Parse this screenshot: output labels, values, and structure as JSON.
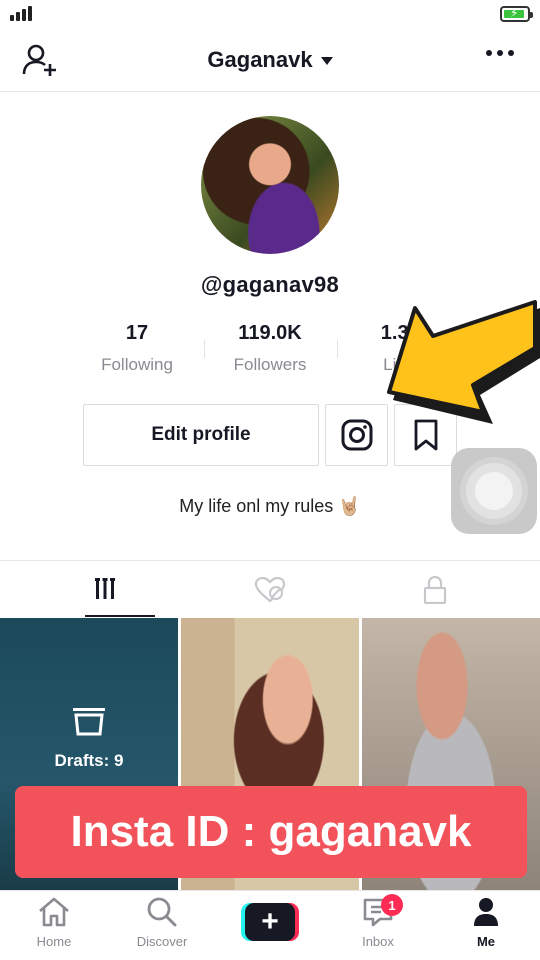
{
  "header": {
    "title": "Gaganavk"
  },
  "profile": {
    "username": "@gaganav98",
    "stats": [
      {
        "value": "17",
        "label": "Following"
      },
      {
        "value": "119.0K",
        "label": "Followers"
      },
      {
        "value": "1.3M",
        "label": "Likes"
      }
    ],
    "edit_label": "Edit profile",
    "bio": "My life onl my rules 🤘🏼"
  },
  "grid": {
    "drafts_label": "Drafts: 9"
  },
  "overlay": {
    "banner_text": "Insta ID : gaganavk"
  },
  "nav": {
    "home": "Home",
    "discover": "Discover",
    "inbox": "Inbox",
    "inbox_badge": "1",
    "me": "Me"
  },
  "colors": {
    "accent": "#fe2c55",
    "banner": "#f2525a",
    "arrow": "#ffc21a"
  }
}
